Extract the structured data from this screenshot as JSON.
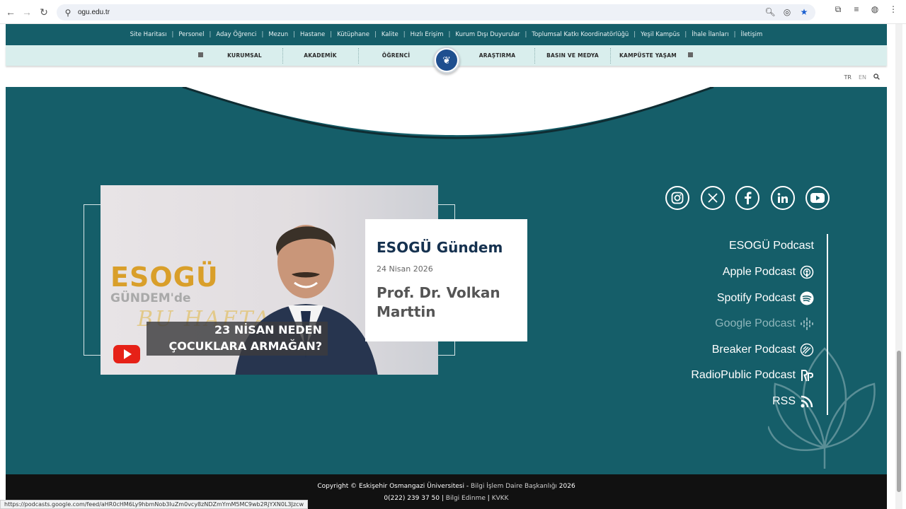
{
  "browser": {
    "url": "ogu.edu.tr",
    "status_url": "https://podcasts.google.com/feed/aHR0cHM6Ly9hbmNob3IuZm0vcy8zNDZmYmM5MC9wb2RjYXN0L3Jzcw"
  },
  "topbar": {
    "links": [
      "Site Haritası",
      "Personel",
      "Aday Öğrenci",
      "Mezun",
      "Hastane",
      "Kütüphane",
      "Kalite",
      "Hızlı Erişim",
      "Kurum Dışı Duyurular",
      "Toplumsal Katkı Koordinatörlüğü",
      "Yeşil Kampüs",
      "İhale İlanları",
      "İletişim"
    ],
    "separator": "|"
  },
  "mainnav": {
    "items": [
      "KURUMSAL",
      "AKADEMİK",
      "ÖĞRENCİ",
      "ARAŞTIRMA",
      "BASIN VE MEDYA",
      "KAMPÜSTE YAŞAM"
    ]
  },
  "lang": {
    "tr": "TR",
    "en": "EN"
  },
  "video": {
    "brand": "ESOGÜ",
    "subtitle": "GÜNDEM'de",
    "script_text": "BU HAFTA",
    "banner_line1": "23 NİSAN NEDEN",
    "banner_line2": "ÇOCUKLARA ARMAĞAN?"
  },
  "card": {
    "title": "ESOGÜ Gündem",
    "date": "24 Nisan 2026",
    "name": "Prof. Dr. Volkan Marttin"
  },
  "social": [
    "instagram-icon",
    "x-icon",
    "facebook-icon",
    "linkedin-icon",
    "youtube-icon"
  ],
  "podcasts": [
    {
      "label": "ESOGÜ Podcast",
      "icon": ""
    },
    {
      "label": "Apple Podcast",
      "icon": "apple-podcast-icon"
    },
    {
      "label": "Spotify Podcast",
      "icon": "spotify-icon"
    },
    {
      "label": "Google Podcast",
      "icon": "google-podcast-icon"
    },
    {
      "label": "Breaker Podcast",
      "icon": "breaker-icon"
    },
    {
      "label": "RadioPublic Podcast",
      "icon": "radiopublic-icon"
    },
    {
      "label": "RSS",
      "icon": "rss-icon"
    }
  ],
  "footer": {
    "copyright_prefix": "Copyright © Eskişehir Osmangazi Üniversitesi - ",
    "department": "Bilgi İşlem Daire Başkanlığı",
    "year": " 2026",
    "phone": "0(222) 239 37 50",
    "sep": " | ",
    "link1": "Bilgi Edinme",
    "link2": "KVKK"
  },
  "colors": {
    "teal": "#155e69",
    "navlight": "#d9eeed",
    "navy": "#15314f",
    "gold": "#d99f2a",
    "footer": "#111111"
  }
}
